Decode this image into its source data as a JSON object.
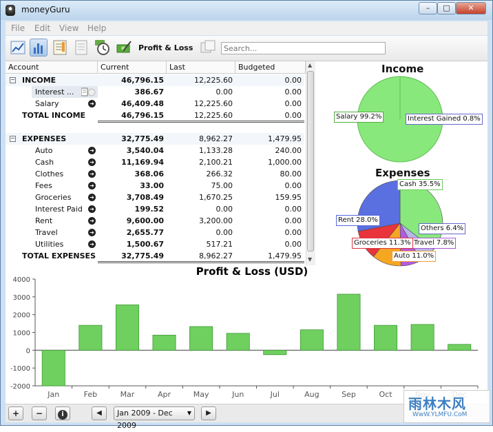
{
  "window": {
    "title": "moneyGuru"
  },
  "menu": [
    "File",
    "Edit",
    "View",
    "Help"
  ],
  "toolbar": {
    "view_title": "Profit & Loss",
    "search_placeholder": "Search..."
  },
  "table": {
    "headers": [
      "Account",
      "Current",
      "Last",
      "Budgeted"
    ],
    "income": {
      "label": "INCOME",
      "current": "46,796.15",
      "last": "12,225.60",
      "budgeted": "0.00",
      "rows": [
        {
          "name": "Interest ...",
          "current": "386.67",
          "last": "0.00",
          "budgeted": "0.00"
        },
        {
          "name": "Salary",
          "current": "46,409.48",
          "last": "12,225.60",
          "budgeted": "0.00"
        }
      ],
      "total": {
        "label": "TOTAL INCOME",
        "current": "46,796.15",
        "last": "12,225.60",
        "budgeted": "0.00"
      }
    },
    "expenses": {
      "label": "EXPENSES",
      "current": "32,775.49",
      "last": "8,962.27",
      "budgeted": "1,479.95",
      "rows": [
        {
          "name": "Auto",
          "current": "3,540.04",
          "last": "1,133.28",
          "budgeted": "240.00"
        },
        {
          "name": "Cash",
          "current": "11,169.94",
          "last": "2,100.21",
          "budgeted": "1,000.00"
        },
        {
          "name": "Clothes",
          "current": "368.06",
          "last": "266.32",
          "budgeted": "80.00"
        },
        {
          "name": "Fees",
          "current": "33.00",
          "last": "75.00",
          "budgeted": "0.00"
        },
        {
          "name": "Groceries",
          "current": "3,708.49",
          "last": "1,670.25",
          "budgeted": "159.95"
        },
        {
          "name": "Interest Paid",
          "current": "199.52",
          "last": "0.00",
          "budgeted": "0.00"
        },
        {
          "name": "Rent",
          "current": "9,600.00",
          "last": "3,200.00",
          "budgeted": "0.00"
        },
        {
          "name": "Travel",
          "current": "2,655.77",
          "last": "0.00",
          "budgeted": "0.00"
        },
        {
          "name": "Utilities",
          "current": "1,500.67",
          "last": "517.21",
          "budgeted": "0.00"
        }
      ],
      "total": {
        "label": "TOTAL EXPENSES",
        "current": "32,775.49",
        "last": "8,962.27",
        "budgeted": "1,479.95"
      }
    }
  },
  "pies": {
    "income": {
      "title": "Income",
      "slices": [
        {
          "label": "Salary 99.2%",
          "percent": 99.2,
          "color": "#89e87c"
        },
        {
          "label": "Interest Gained 0.8%",
          "percent": 0.8,
          "color": "#6b6bd6"
        }
      ]
    },
    "expenses": {
      "title": "Expenses",
      "slices": [
        {
          "label": "Cash 35.5%",
          "percent": 35.5,
          "color": "#89e87c",
          "border": "#66cc55"
        },
        {
          "label": "Others 6.4%",
          "percent": 6.4,
          "color": "#b6b6e8",
          "border": "#6666cc"
        },
        {
          "label": "Travel 7.8%",
          "percent": 7.8,
          "color": "#b45ae0",
          "border": "#aa55dd"
        },
        {
          "label": "Auto 11.0%",
          "percent": 11.0,
          "color": "#f5a623",
          "border": "#f0a030"
        },
        {
          "label": "Groceries 11.3%",
          "percent": 11.3,
          "color": "#e8343a",
          "border": "#dd3344"
        },
        {
          "label": "Rent 28.0%",
          "percent": 28.0,
          "color": "#5a6fe0",
          "border": "#5566dd"
        }
      ]
    }
  },
  "chart_data": {
    "type": "bar",
    "title": "Profit & Loss (USD)",
    "categories": [
      "Jan",
      "Feb",
      "Mar",
      "Apr",
      "May",
      "Jun",
      "Jul",
      "Aug",
      "Sep",
      "Oct",
      "Nov",
      "Dec"
    ],
    "values": [
      -2000,
      1400,
      2550,
      850,
      1330,
      950,
      -250,
      1150,
      3150,
      1400,
      1450,
      330
    ],
    "yticks": [
      -2000,
      -1000,
      0,
      1000,
      2000,
      3000,
      4000
    ],
    "ylim": [
      -2000,
      4000
    ],
    "bar_color": "#6fcf5f",
    "grid": false
  },
  "bottombar": {
    "add": "+",
    "remove": "−",
    "info": "i",
    "prev": "◀",
    "next": "▶",
    "date_range": "Jan 2009 - Dec 2009"
  },
  "watermark": {
    "line1": "雨林木风",
    "line2": "WwW.YLMFU.CoM"
  }
}
